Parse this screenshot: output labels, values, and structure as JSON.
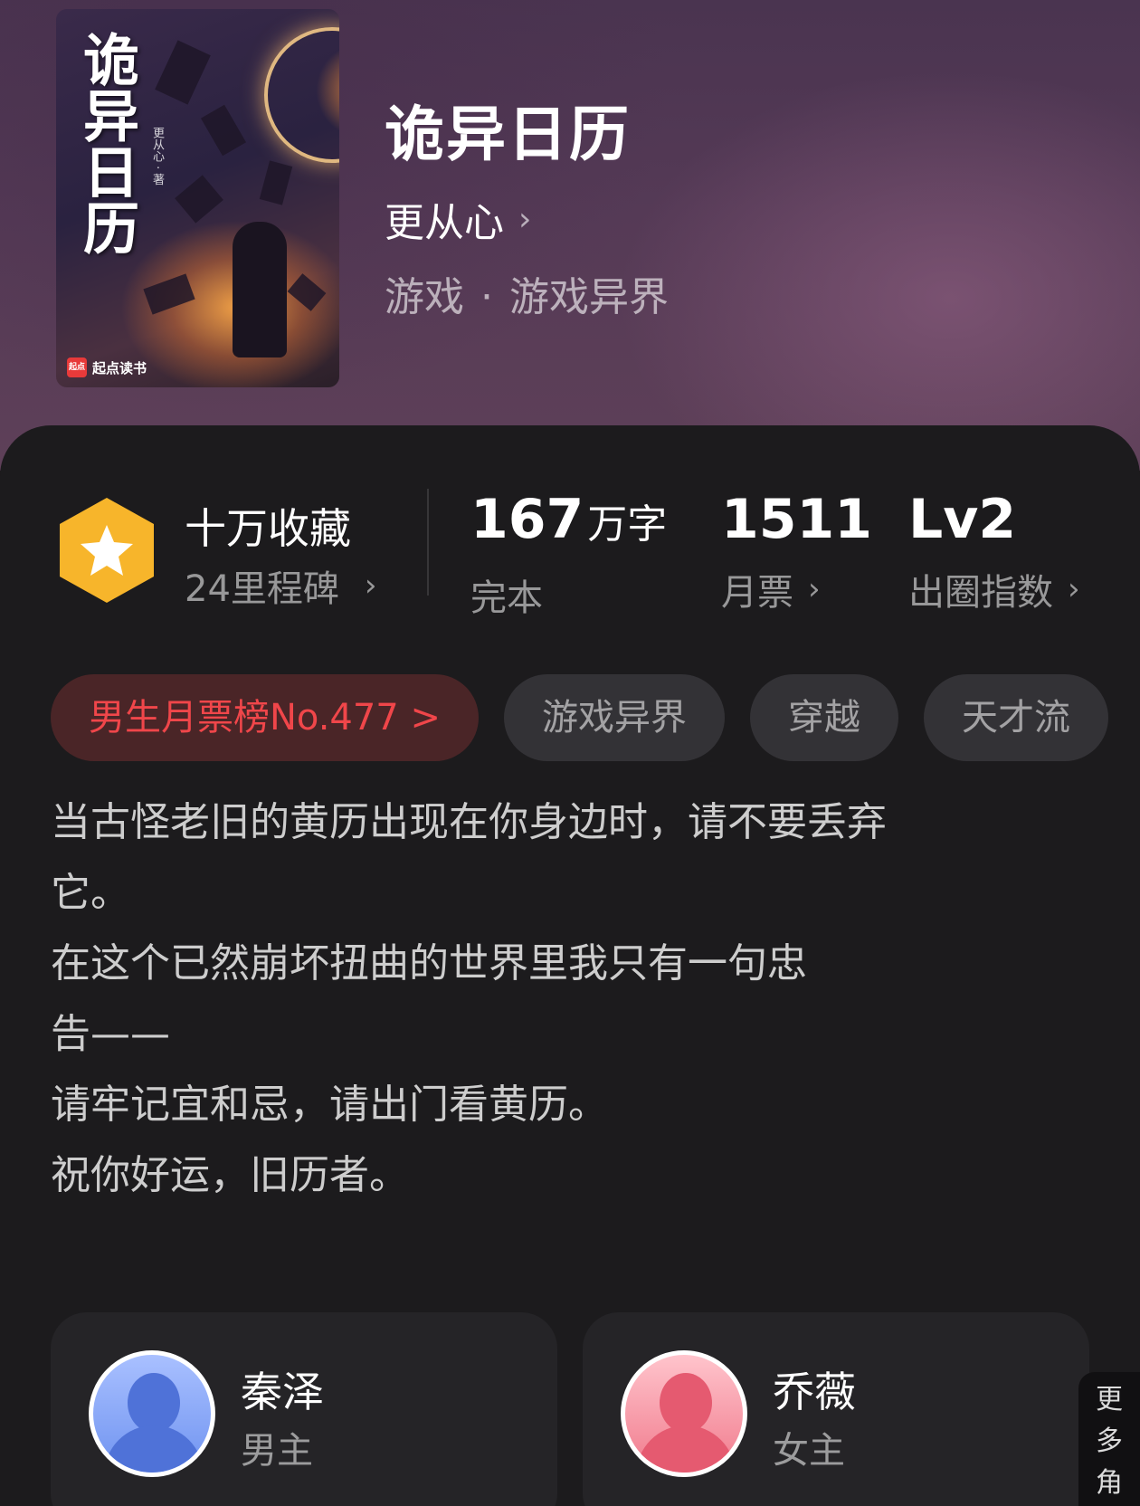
{
  "book": {
    "cover_title": "诡异日历",
    "cover_author": "更从心 · 著",
    "publisher": "起点读书",
    "publisher_logo": "起点",
    "title": "诡异日历",
    "author": "更从心",
    "author_chevron": "›",
    "genre_main": "游戏",
    "genre_sep": "·",
    "genre_sub": "游戏异界"
  },
  "stats": {
    "badge_icon": "star-hexagon-icon",
    "badge_color": "#f7b52b",
    "badge_label": "十万收藏",
    "badge_sub": "24里程碑",
    "words_value": "167",
    "words_unit": "万字",
    "words_label": "完本",
    "tickets_value": "1511",
    "tickets_label": "月票",
    "level_value": "Lv2",
    "level_label": "出圈指数",
    "chevron": "›"
  },
  "tags": [
    {
      "label": "男生月票榜No.477 >"
    },
    {
      "label": "游戏异界"
    },
    {
      "label": "穿越"
    },
    {
      "label": "天才流"
    }
  ],
  "description": [
    "当古怪老旧的黄历出现在你身边时，请不要丢弃",
    "它。",
    "在这个已然崩坏扭曲的世界里我只有一句忠",
    "告——",
    "请牢记宜和忌，请出门看黄历。",
    "祝你好运，旧历者。"
  ],
  "characters": [
    {
      "name": "秦泽",
      "role": "男主"
    },
    {
      "name": "乔薇",
      "role": "女主"
    }
  ],
  "more_roles": "更多角",
  "colors": {
    "rank_text": "#f0464a",
    "rank_bg": "#4a2527",
    "tag_bg": "#333236",
    "page_bg": "#1c1b1d"
  }
}
